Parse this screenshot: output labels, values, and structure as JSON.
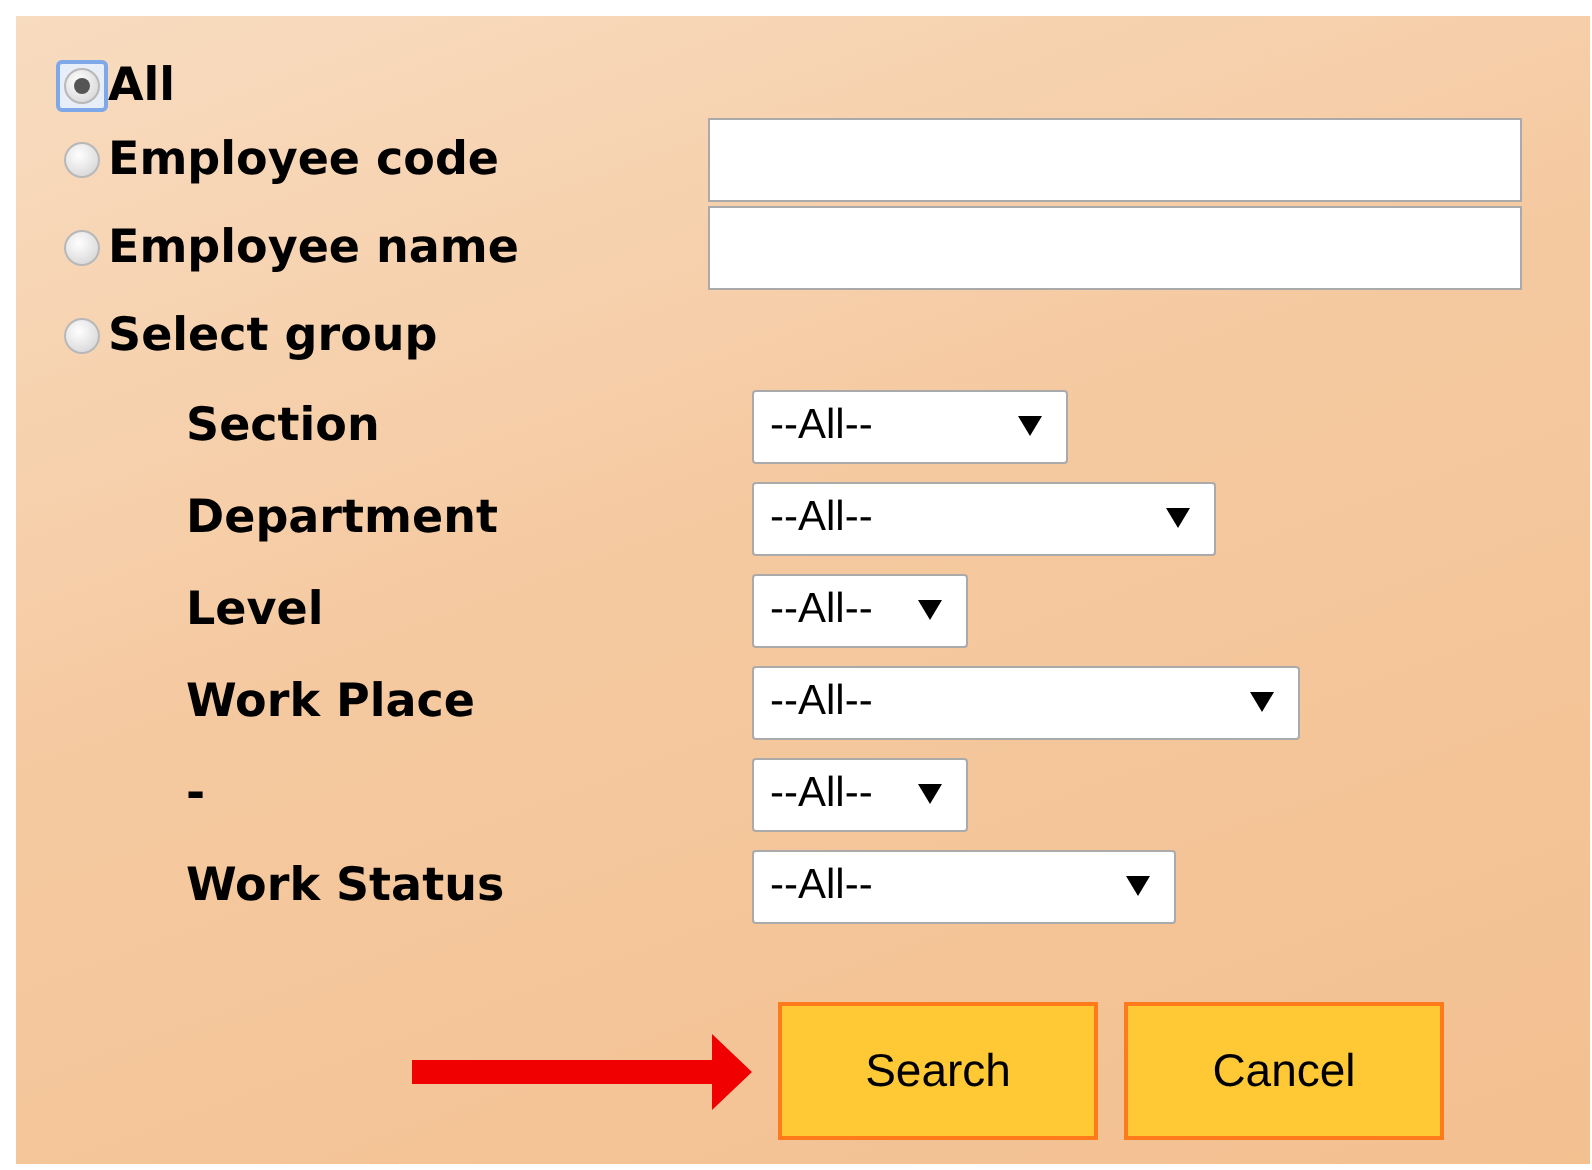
{
  "filter_options": [
    {
      "label": "All",
      "selected": true,
      "kind": "plain"
    },
    {
      "label": "Employee code",
      "selected": false,
      "kind": "text"
    },
    {
      "label": "Employee name",
      "selected": false,
      "kind": "text"
    },
    {
      "label": "Select group",
      "selected": false,
      "kind": "plain"
    }
  ],
  "group_fields": [
    {
      "label": "Section",
      "value": "--All--"
    },
    {
      "label": "Department",
      "value": "--All--"
    },
    {
      "label": "Level",
      "value": "--All--"
    },
    {
      "label": "Work Place",
      "value": "--All--"
    },
    {
      "label": "-",
      "value": "--All--"
    },
    {
      "label": "Work Status",
      "value": "--All--"
    }
  ],
  "buttons": [
    "Search",
    "Cancel"
  ]
}
